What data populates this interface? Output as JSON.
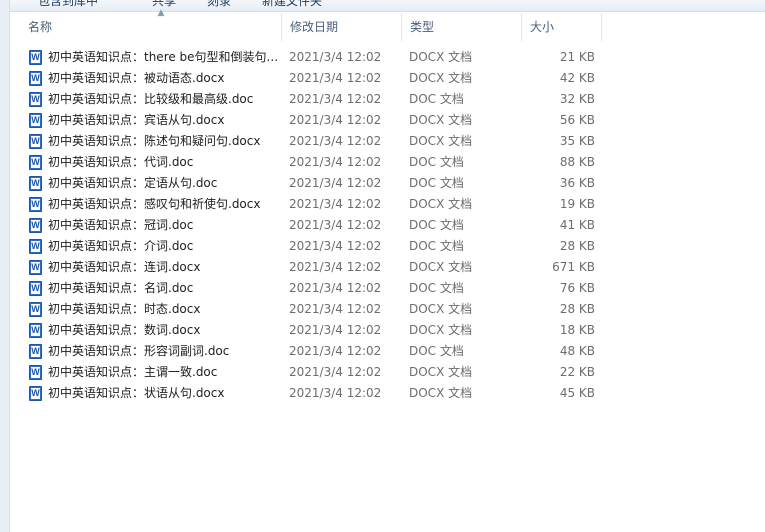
{
  "toolbar": {
    "items": [
      "包含到库中",
      "共享",
      "刻录",
      "新建文件夹"
    ]
  },
  "columns": {
    "name": "名称",
    "date": "修改日期",
    "type": "类型",
    "size": "大小"
  },
  "files": [
    {
      "name": "初中英语知识点：there be句型和倒装句...",
      "date": "2021/3/4 12:02",
      "type": "DOCX 文档",
      "size": "21 KB"
    },
    {
      "name": "初中英语知识点：被动语态.docx",
      "date": "2021/3/4 12:02",
      "type": "DOCX 文档",
      "size": "42 KB"
    },
    {
      "name": "初中英语知识点：比较级和最高级.doc",
      "date": "2021/3/4 12:02",
      "type": "DOC 文档",
      "size": "32 KB"
    },
    {
      "name": "初中英语知识点：宾语从句.docx",
      "date": "2021/3/4 12:02",
      "type": "DOCX 文档",
      "size": "56 KB"
    },
    {
      "name": "初中英语知识点：陈述句和疑问句.docx",
      "date": "2021/3/4 12:02",
      "type": "DOCX 文档",
      "size": "35 KB"
    },
    {
      "name": "初中英语知识点：代词.doc",
      "date": "2021/3/4 12:02",
      "type": "DOC 文档",
      "size": "88 KB"
    },
    {
      "name": "初中英语知识点：定语从句.doc",
      "date": "2021/3/4 12:02",
      "type": "DOC 文档",
      "size": "36 KB"
    },
    {
      "name": "初中英语知识点：感叹句和祈使句.docx",
      "date": "2021/3/4 12:02",
      "type": "DOCX 文档",
      "size": "19 KB"
    },
    {
      "name": "初中英语知识点：冠词.doc",
      "date": "2021/3/4 12:02",
      "type": "DOC 文档",
      "size": "41 KB"
    },
    {
      "name": "初中英语知识点：介词.doc",
      "date": "2021/3/4 12:02",
      "type": "DOC 文档",
      "size": "28 KB"
    },
    {
      "name": "初中英语知识点：连词.docx",
      "date": "2021/3/4 12:02",
      "type": "DOCX 文档",
      "size": "671 KB"
    },
    {
      "name": "初中英语知识点：名词.doc",
      "date": "2021/3/4 12:02",
      "type": "DOC 文档",
      "size": "76 KB"
    },
    {
      "name": "初中英语知识点：时态.docx",
      "date": "2021/3/4 12:02",
      "type": "DOCX 文档",
      "size": "28 KB"
    },
    {
      "name": "初中英语知识点：数词.docx",
      "date": "2021/3/4 12:02",
      "type": "DOCX 文档",
      "size": "18 KB"
    },
    {
      "name": "初中英语知识点：形容词副词.doc",
      "date": "2021/3/4 12:02",
      "type": "DOC 文档",
      "size": "48 KB"
    },
    {
      "name": "初中英语知识点：主谓一致.doc",
      "date": "2021/3/4 12:02",
      "type": "DOCX 文档",
      "size": "22 KB"
    },
    {
      "name": "初中英语知识点：状语从句.docx",
      "date": "2021/3/4 12:02",
      "type": "DOCX 文档",
      "size": "45 KB"
    }
  ]
}
